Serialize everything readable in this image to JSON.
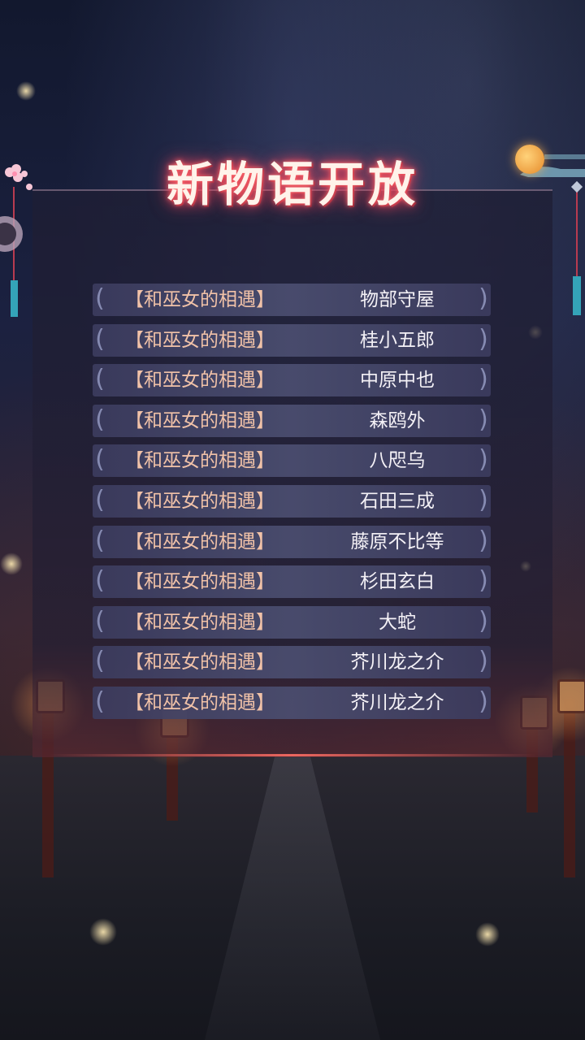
{
  "title": "新物语开放",
  "entries": [
    {
      "tag": "【和巫女的相遇】",
      "name": "物部守屋"
    },
    {
      "tag": "【和巫女的相遇】",
      "name": "桂小五郎"
    },
    {
      "tag": "【和巫女的相遇】",
      "name": "中原中也"
    },
    {
      "tag": "【和巫女的相遇】",
      "name": "森鸥外"
    },
    {
      "tag": "【和巫女的相遇】",
      "name": "八咫乌"
    },
    {
      "tag": "【和巫女的相遇】",
      "name": "石田三成"
    },
    {
      "tag": "【和巫女的相遇】",
      "name": "藤原不比等"
    },
    {
      "tag": "【和巫女的相遇】",
      "name": "杉田玄白"
    },
    {
      "tag": "【和巫女的相遇】",
      "name": "大蛇"
    },
    {
      "tag": "【和巫女的相遇】",
      "name": "芥川龙之介"
    },
    {
      "tag": "【和巫女的相遇】",
      "name": "芥川龙之介"
    }
  ],
  "colors": {
    "title_glow": "#e03c5a",
    "tag_text": "#f1c2a8",
    "name_text": "#f4f1f6",
    "row_bg": "#4b4e70"
  },
  "icons": {
    "left_decoration": "sakura-ornament-icon",
    "right_decoration": "moon-cloud-icon"
  }
}
